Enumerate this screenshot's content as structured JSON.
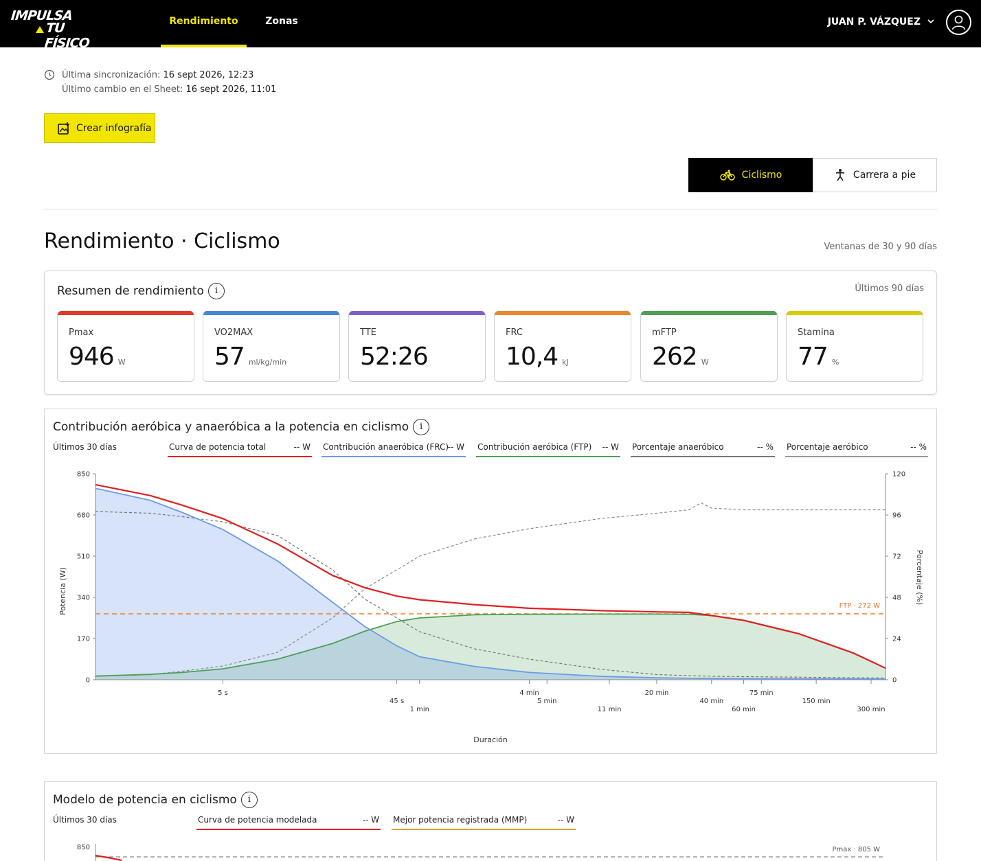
{
  "header": {
    "logo_line1": "IMPULSA",
    "logo_line2": "TU FÍSICO",
    "tabs": [
      {
        "label": "Rendimiento",
        "active": true
      },
      {
        "label": "Zonas",
        "active": false
      }
    ],
    "user_name": "JUAN P. VÁZQUEZ"
  },
  "sync": {
    "last_sync_label": "Última sincronización:",
    "last_sync_value": "16 sept 2026, 12:23",
    "last_change_label": "Último cambio en el Sheet:",
    "last_change_value": "16 sept 2026, 11:01"
  },
  "create_infographic_label": "Crear infografía",
  "sport_toggle": {
    "cycling_label": "Ciclismo",
    "running_label": "Carrera a pie",
    "selected": "Ciclismo"
  },
  "page_title": "Rendimiento · Ciclismo",
  "window_note": "Ventanas de 30 y 90 días",
  "summary": {
    "title": "Resumen de rendimiento",
    "info": "i",
    "period": "Últimos 90 días",
    "metrics": [
      {
        "label": "Pmax",
        "value": "946",
        "unit": "W",
        "color": "#e03a2f"
      },
      {
        "label": "VO2MAX",
        "value": "57",
        "unit": "ml/kg/min",
        "color": "#4a86d8"
      },
      {
        "label": "TTE",
        "value": "52:26",
        "unit": "",
        "color": "#8060c8"
      },
      {
        "label": "FRC",
        "value": "10,4",
        "unit": "kJ",
        "color": "#e8872b"
      },
      {
        "label": "mFTP",
        "value": "262",
        "unit": "W",
        "color": "#4e9f55"
      },
      {
        "label": "Stamina",
        "value": "77",
        "unit": "%",
        "color": "#d8cc00"
      }
    ]
  },
  "contribution_chart": {
    "title": "Contribución aeróbica y anaeróbica a la potencia en ciclismo",
    "info": "i",
    "period": "Últimos 30 días",
    "legend": [
      {
        "name": "Curva de potencia total",
        "value": "-- W",
        "color": "#e02020"
      },
      {
        "name": "Contribución anaeróbica (FRC)",
        "value": "-- W",
        "color": "#6b9be8"
      },
      {
        "name": "Contribución aeróbica (FTP)",
        "value": "-- W",
        "color": "#4e9f55"
      },
      {
        "name": "Porcentaje anaeróbico",
        "value": "-- %",
        "color": "#777777"
      },
      {
        "name": "Porcentaje aeróbico",
        "value": "-- %",
        "color": "#999999"
      }
    ],
    "ftp_label": "FTP · 272 W",
    "y_left_label": "Potencia (W)",
    "y_right_label": "Porcentaje (%)",
    "x_label": "Duración"
  },
  "chart_data": [
    {
      "type": "area",
      "title": "Contribución aeróbica y anaeróbica a la potencia en ciclismo",
      "xlabel": "Duración",
      "ylabel": "Potencia (W)",
      "y2label": "Porcentaje (%)",
      "x_scale": "log",
      "xlim_seconds": [
        1,
        21600
      ],
      "ylim": [
        0,
        850
      ],
      "y2lim": [
        0,
        120
      ],
      "y_ticks": [
        0,
        170,
        340,
        510,
        680,
        850
      ],
      "y2_ticks": [
        0,
        24,
        48,
        72,
        96,
        120
      ],
      "x_ticks": [
        {
          "label": "5 s",
          "seconds": 5,
          "row": 0
        },
        {
          "label": "45 s",
          "seconds": 45,
          "row": 1
        },
        {
          "label": "1 min",
          "seconds": 60,
          "row": 2
        },
        {
          "label": "4 min",
          "seconds": 240,
          "row": 0
        },
        {
          "label": "5 min",
          "seconds": 300,
          "row": 1
        },
        {
          "label": "11 min",
          "seconds": 660,
          "row": 2
        },
        {
          "label": "20 min",
          "seconds": 1200,
          "row": 0
        },
        {
          "label": "40 min",
          "seconds": 2400,
          "row": 1
        },
        {
          "label": "60 min",
          "seconds": 3600,
          "row": 2
        },
        {
          "label": "75 min",
          "seconds": 4500,
          "row": 0
        },
        {
          "label": "150 min",
          "seconds": 9000,
          "row": 1
        },
        {
          "label": "300 min",
          "seconds": 18000,
          "row": 2
        }
      ],
      "ftp_line": 272,
      "series": [
        {
          "name": "Curva de potencia total",
          "axis": "left",
          "x_seconds": [
            1,
            2,
            3,
            5,
            10,
            20,
            30,
            45,
            60,
            120,
            240,
            600,
            1200,
            1800,
            2400,
            3600,
            7200,
            14400,
            21600
          ],
          "values": [
            805,
            760,
            720,
            665,
            560,
            430,
            380,
            345,
            330,
            310,
            295,
            285,
            280,
            278,
            265,
            245,
            190,
            110,
            48
          ]
        },
        {
          "name": "Contribución anaeróbica (FRC)",
          "axis": "left",
          "x_seconds": [
            1,
            2,
            3,
            5,
            10,
            20,
            30,
            45,
            60,
            120,
            240,
            600,
            1200,
            2400,
            21600
          ],
          "values": [
            790,
            740,
            690,
            620,
            490,
            320,
            220,
            140,
            95,
            55,
            30,
            14,
            8,
            5,
            3
          ]
        },
        {
          "name": "Contribución aeróbica (FTP)",
          "axis": "left",
          "x_seconds": [
            1,
            2,
            3,
            5,
            10,
            20,
            30,
            45,
            60,
            120,
            240,
            600,
            1200,
            1800,
            2400,
            3600,
            7200,
            14400,
            21600
          ],
          "values": [
            15,
            22,
            30,
            45,
            85,
            150,
            200,
            240,
            255,
            268,
            270,
            271,
            271,
            270,
            265,
            245,
            190,
            110,
            48
          ]
        },
        {
          "name": "Porcentaje anaeróbico",
          "axis": "right",
          "x_seconds": [
            1,
            2,
            3,
            5,
            10,
            20,
            30,
            45,
            60,
            120,
            240,
            600,
            1200,
            2400,
            21600
          ],
          "values": [
            98,
            97,
            95,
            92,
            84,
            64,
            47,
            36,
            28,
            18,
            12,
            6,
            3,
            2,
            1
          ]
        },
        {
          "name": "Porcentaje aeróbico",
          "axis": "right",
          "x_seconds": [
            1,
            2,
            3,
            5,
            10,
            20,
            30,
            45,
            60,
            120,
            240,
            600,
            1200,
            1800,
            2100,
            2400,
            3600,
            21600
          ],
          "values": [
            2,
            3,
            5,
            8,
            16,
            36,
            53,
            64,
            72,
            82,
            88,
            94,
            97,
            99,
            103,
            100,
            99,
            99
          ]
        }
      ]
    },
    {
      "type": "line",
      "title": "Modelo de potencia en ciclismo",
      "ylim": [
        0,
        850
      ],
      "y_ticks": [
        850
      ],
      "reference_line": {
        "label": "Pmax · 805 W",
        "value": 805
      },
      "series": [
        {
          "name": "Curva de potencia modelada",
          "values": []
        },
        {
          "name": "Mejor potencia registrada (MMP)",
          "values": []
        }
      ]
    }
  ],
  "model_chart": {
    "title": "Modelo de potencia en ciclismo",
    "info": "i",
    "period": "Últimos 30 días",
    "legend": [
      {
        "name": "Curva de potencia modelada",
        "value": "-- W",
        "color": "#e02020"
      },
      {
        "name": "Mejor potencia registrada (MMP)",
        "value": "-- W",
        "color": "#e0a020"
      }
    ],
    "pmax_label": "Pmax · 805 W",
    "y_top_tick": "850"
  },
  "icons": {
    "clock": "clock-icon",
    "image_add": "image-add-icon",
    "bike": "bike-icon",
    "runner": "runner-icon",
    "user": "user-icon",
    "chevron": "chevron-down-icon"
  },
  "colors": {
    "accent": "#f2e600",
    "nav_bg": "#000000"
  }
}
